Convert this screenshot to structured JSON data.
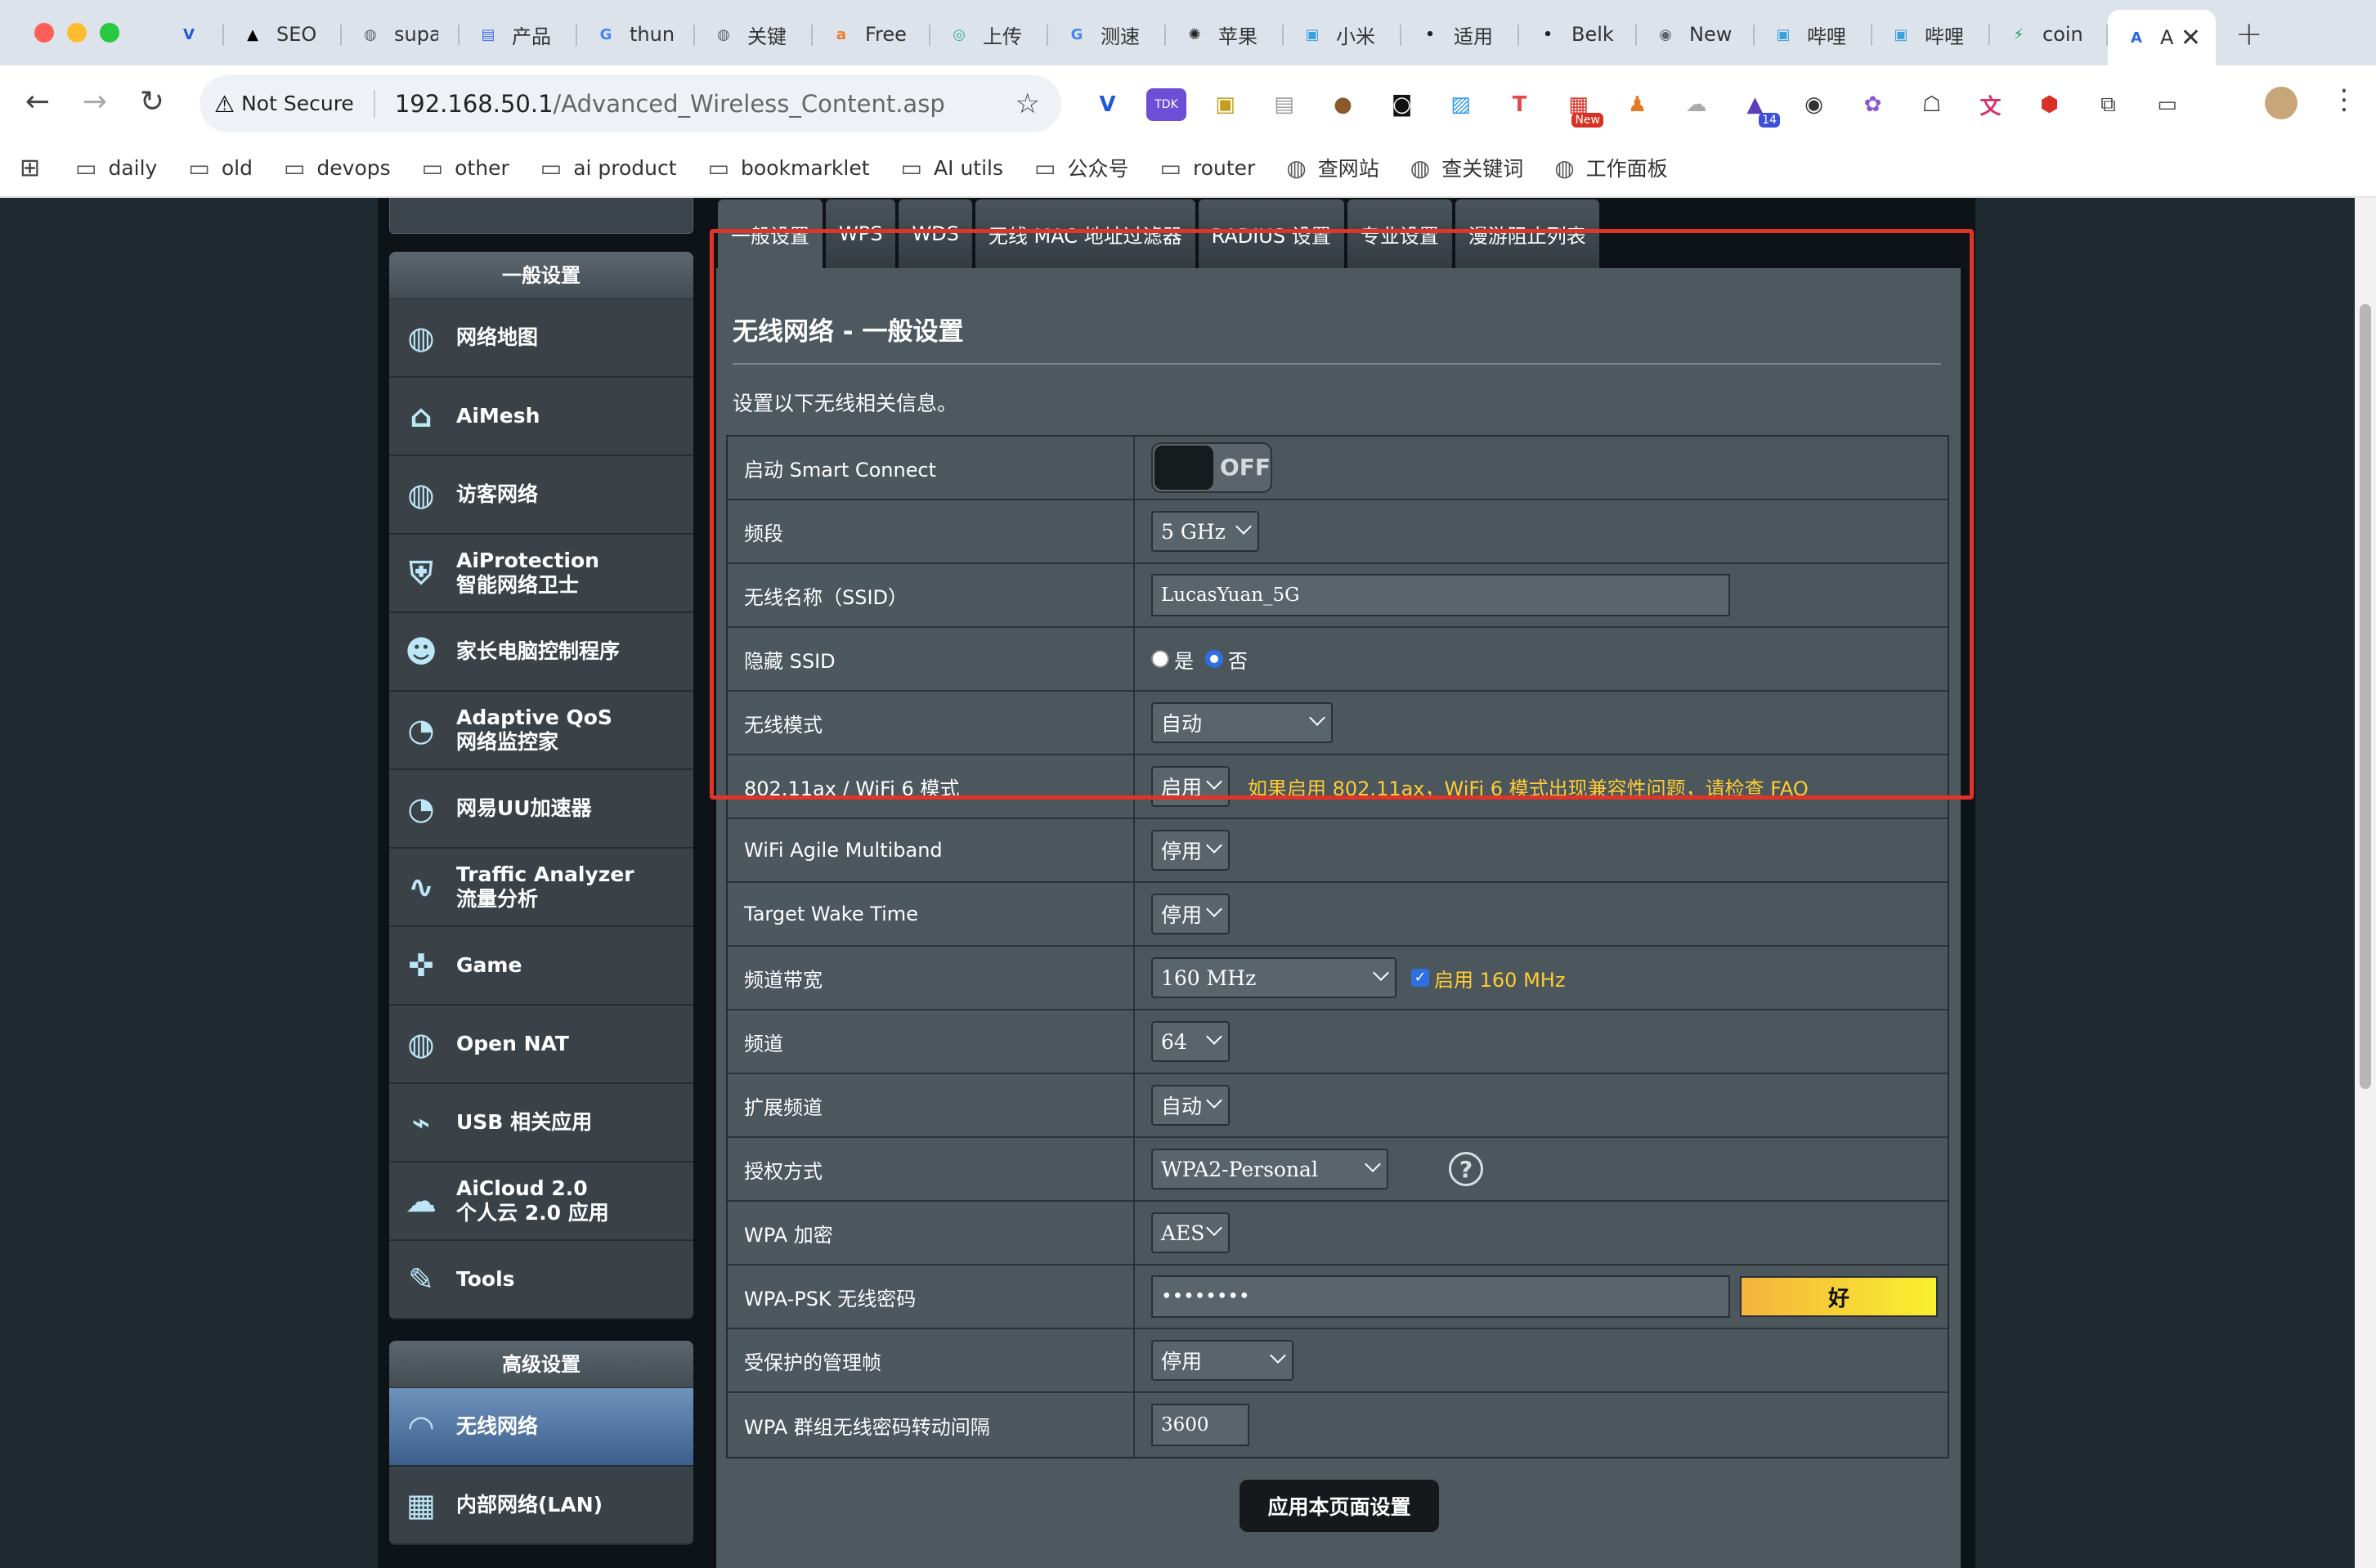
{
  "browser": {
    "tabs": [
      {
        "label": "",
        "icon": "vercel-like-v-icon",
        "color": "#1f59d9"
      },
      {
        "label": "SEO",
        "icon": "triangle-icon",
        "color": "#000000"
      },
      {
        "label": "supa",
        "icon": "globe-icon",
        "color": "#5f6368"
      },
      {
        "label": "产品",
        "icon": "doc-icon",
        "color": "#3b6ef0"
      },
      {
        "label": "thun",
        "icon": "google-icon",
        "color": "#4285f4"
      },
      {
        "label": "关键",
        "icon": "globe-icon",
        "color": "#5f6368"
      },
      {
        "label": "Free",
        "icon": "a-letter-icon",
        "color": "#f07d28"
      },
      {
        "label": "上传",
        "icon": "ring-icon",
        "color": "#3fae8c"
      },
      {
        "label": "测速",
        "icon": "google-icon",
        "color": "#4285f4"
      },
      {
        "label": "苹果",
        "icon": "openai-icon",
        "color": "#222222"
      },
      {
        "label": "小米",
        "icon": "bilibili-icon",
        "color": "#3aa1e0"
      },
      {
        "label": "适用",
        "icon": "apple-icon",
        "color": "#222222"
      },
      {
        "label": "Belk",
        "icon": "apple-icon",
        "color": "#222222"
      },
      {
        "label": "New",
        "icon": "chrome-icon",
        "color": "#5f6368"
      },
      {
        "label": "哔哩",
        "icon": "bilibili-icon",
        "color": "#3aa1e0"
      },
      {
        "label": "哔哩",
        "icon": "bilibili-icon",
        "color": "#3aa1e0"
      },
      {
        "label": "coin",
        "icon": "bolt-icon",
        "color": "#1a9b55"
      },
      {
        "label": "A",
        "icon": "asus-a-icon",
        "color": "#2a6ae0"
      }
    ],
    "not_secure_label": "Not Secure",
    "url_host": "192.168.50.1",
    "url_path": "/Advanced_Wireless_Content.asp",
    "bookmarks": [
      {
        "label": "daily",
        "icon": "folder-icon"
      },
      {
        "label": "old",
        "icon": "folder-icon"
      },
      {
        "label": "devops",
        "icon": "folder-icon"
      },
      {
        "label": "other",
        "icon": "folder-icon"
      },
      {
        "label": "ai product",
        "icon": "folder-icon"
      },
      {
        "label": "bookmarklet",
        "icon": "folder-icon"
      },
      {
        "label": "AI utils",
        "icon": "folder-icon"
      },
      {
        "label": "公众号",
        "icon": "folder-icon"
      },
      {
        "label": "router",
        "icon": "folder-icon"
      },
      {
        "label": "查网站",
        "icon": "globe-icon"
      },
      {
        "label": "查关键词",
        "icon": "globe-icon"
      },
      {
        "label": "工作面板",
        "icon": "globe-icon"
      }
    ],
    "extension_badges": {
      "new": "New",
      "count": "14"
    }
  },
  "sidebar": {
    "general_header": "一般设置",
    "general_items": [
      {
        "label": "网络地图",
        "sub": "",
        "icon": "globe-network-icon"
      },
      {
        "label": "AiMesh",
        "sub": "",
        "icon": "aimesh-icon"
      },
      {
        "label": "访客网络",
        "sub": "",
        "icon": "guest-network-icon"
      },
      {
        "label": "AiProtection",
        "sub": "智能网络卫士",
        "icon": "shield-lock-icon"
      },
      {
        "label": "家长电脑控制程序",
        "sub": "",
        "icon": "family-icon"
      },
      {
        "label": "Adaptive QoS",
        "sub": "网络监控家",
        "icon": "gauge-icon"
      },
      {
        "label": "网易UU加速器",
        "sub": "",
        "icon": "gauge-icon"
      },
      {
        "label": "Traffic Analyzer",
        "sub": "流量分析",
        "icon": "pulse-icon"
      },
      {
        "label": "Game",
        "sub": "",
        "icon": "gamepad-icon"
      },
      {
        "label": "Open NAT",
        "sub": "",
        "icon": "open-nat-icon"
      },
      {
        "label": "USB 相关应用",
        "sub": "",
        "icon": "usb-icon"
      },
      {
        "label": "AiCloud 2.0",
        "sub": "个人云 2.0 应用",
        "icon": "cloud-icon"
      },
      {
        "label": "Tools",
        "sub": "",
        "icon": "wrench-icon"
      }
    ],
    "advanced_header": "高级设置",
    "advanced_items": [
      {
        "label": "无线网络",
        "icon": "wifi-icon",
        "selected": true
      },
      {
        "label": "内部网络(LAN)",
        "icon": "lan-icon",
        "selected": false
      }
    ]
  },
  "content_tabs": [
    "一般设置",
    "WPS",
    "WDS",
    "无线 MAC 地址过滤器",
    "RADIUS 设置",
    "专业设置",
    "漫游阻止列表"
  ],
  "page": {
    "heading": "无线网络 - 一般设置",
    "description": "设置以下无线相关信息。",
    "apply_button": "应用本页面设置"
  },
  "form": {
    "smart_connect": {
      "label": "启动 Smart Connect",
      "state": "OFF"
    },
    "band": {
      "label": "频段",
      "value": "5 GHz"
    },
    "ssid": {
      "label": "无线名称（SSID）",
      "value": "LucasYuan_5G"
    },
    "hide_ssid": {
      "label": "隐藏 SSID",
      "yes": "是",
      "no": "否",
      "selected": "否"
    },
    "wireless_mode": {
      "label": "无线模式",
      "value": "自动"
    },
    "ax_mode": {
      "label": "802.11ax / WiFi 6 模式",
      "value": "启用",
      "note": "如果启用 802.11ax，WiFi 6 模式出现兼容性问题，请检查 ",
      "note_link": "FAQ"
    },
    "agile_multiband": {
      "label": "WiFi Agile Multiband",
      "value": "停用"
    },
    "target_wake_time": {
      "label": "Target Wake Time",
      "value": "停用"
    },
    "channel_bandwidth": {
      "label": "频道带宽",
      "value": "160 MHz",
      "check_label": "启用 160 MHz",
      "checked": true
    },
    "channel": {
      "label": "频道",
      "value": "64"
    },
    "ext_channel": {
      "label": "扩展频道",
      "value": "自动"
    },
    "auth_method": {
      "label": "授权方式",
      "value": "WPA2-Personal"
    },
    "wpa_encryption": {
      "label": "WPA 加密",
      "value": "AES"
    },
    "wpa_psk": {
      "label": "WPA-PSK 无线密码",
      "value": "••••••••",
      "strength": "好"
    },
    "pmf": {
      "label": "受保护的管理帧",
      "value": "停用"
    },
    "group_key_interval": {
      "label": "WPA 群组无线密码转动间隔",
      "value": "3600"
    }
  },
  "colors": {
    "highlight": "#e23426",
    "note": "#ffcc33",
    "selected_menu": "#4f74a4"
  }
}
